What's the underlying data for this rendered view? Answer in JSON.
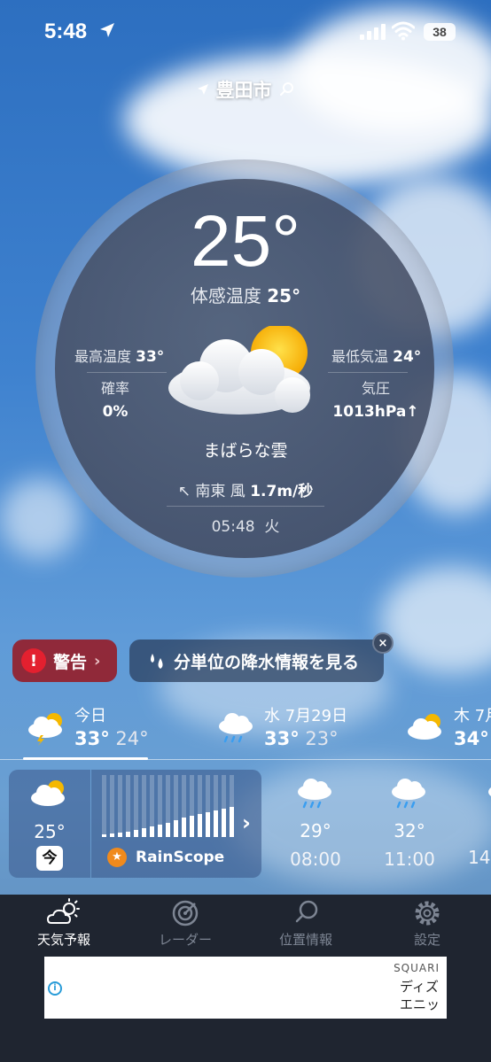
{
  "status_bar": {
    "time": "5:48",
    "battery": "38"
  },
  "location": {
    "city": "豊田市"
  },
  "current": {
    "temp": "25°",
    "feels_label": "体感温度",
    "feels_value": "25°",
    "high_label": "最高温度",
    "high_value": "33°",
    "low_label": "最低気温",
    "low_value": "24°",
    "prob_label": "確率",
    "prob_value": "0%",
    "pressure_label": "気圧",
    "pressure_value": "1013hPa↑",
    "condition": "まばらな雲",
    "wind_dir": "南東 風",
    "wind_speed": "1.7m/秒",
    "updated_time": "05:48",
    "updated_day": "火"
  },
  "actions": {
    "warning_label": "警告",
    "precip_label": "分単位の降水情報を見る"
  },
  "daily": [
    {
      "name": "今日",
      "high": "33°",
      "low": "24°",
      "icon": "partly-sunny-thunder-icon"
    },
    {
      "name": "水 7月29日",
      "high": "33°",
      "low": "23°",
      "icon": "rain-cloud-icon"
    },
    {
      "name": "木 7月",
      "high": "34°",
      "low": "",
      "icon": "partly-sunny-icon"
    }
  ],
  "hourly": {
    "now_temp": "25°",
    "now_badge": "今",
    "rainscope_label": "RainScope",
    "items": [
      {
        "temp": "29°",
        "time": "08:00"
      },
      {
        "temp": "32°",
        "time": "11:00"
      },
      {
        "temp": "",
        "time": "14"
      }
    ]
  },
  "tabs": [
    {
      "label": "天気予報",
      "active": true
    },
    {
      "label": "レーダー",
      "active": false
    },
    {
      "label": "位置情報",
      "active": false
    },
    {
      "label": "設定",
      "active": false
    }
  ],
  "ad": {
    "brand": "SQUARI",
    "line1": "ディズ",
    "line2": "エニッ"
  },
  "colors": {
    "warning": "#e3202f",
    "tabbar": "#1f2530",
    "sun": "#f5b800"
  }
}
